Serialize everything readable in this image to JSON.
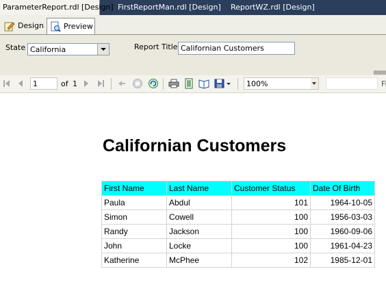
{
  "document_tabs": [
    {
      "label": "ParameterReport.rdl [Design]",
      "active": true
    },
    {
      "label": "FirstReportMan.rdl [Design]",
      "active": false
    },
    {
      "label": "ReportWZ.rdl [Design]",
      "active": false
    }
  ],
  "view_tabs": {
    "design_label": "Design",
    "preview_label": "Preview",
    "active": "Preview"
  },
  "parameters": {
    "state_label": "State",
    "state_value": "California",
    "report_title_label": "Report Title",
    "report_title_value": "Californian Customers"
  },
  "toolbar": {
    "page_value": "1",
    "of_label": "of",
    "total_pages": "1",
    "zoom_value": "100%",
    "find_label": "Fi",
    "icons": [
      "first-page-icon",
      "previous-page-icon",
      "next-page-icon",
      "last-page-icon",
      "back-icon",
      "stop-icon",
      "refresh-icon",
      "print-icon",
      "print-layout-icon",
      "page-setup-icon",
      "export-icon"
    ]
  },
  "report": {
    "title": "Californian Customers",
    "columns": [
      "First Name",
      "Last Name",
      "Customer Status",
      "Date Of Birth"
    ],
    "rows": [
      [
        "Paula",
        "Abdul",
        "101",
        "1964-10-05"
      ],
      [
        "Simon",
        "Cowell",
        "100",
        "1956-03-03"
      ],
      [
        "Randy",
        "Jackson",
        "100",
        "1960-09-06"
      ],
      [
        "John",
        "Locke",
        "100",
        "1961-04-23"
      ],
      [
        "Katherine",
        "McPhee",
        "102",
        "1985-12-01"
      ]
    ],
    "header_color": "#00ffff"
  },
  "colors": {
    "tab_strip": "#2b3e5c",
    "param_bar": "#ebe9dd"
  }
}
